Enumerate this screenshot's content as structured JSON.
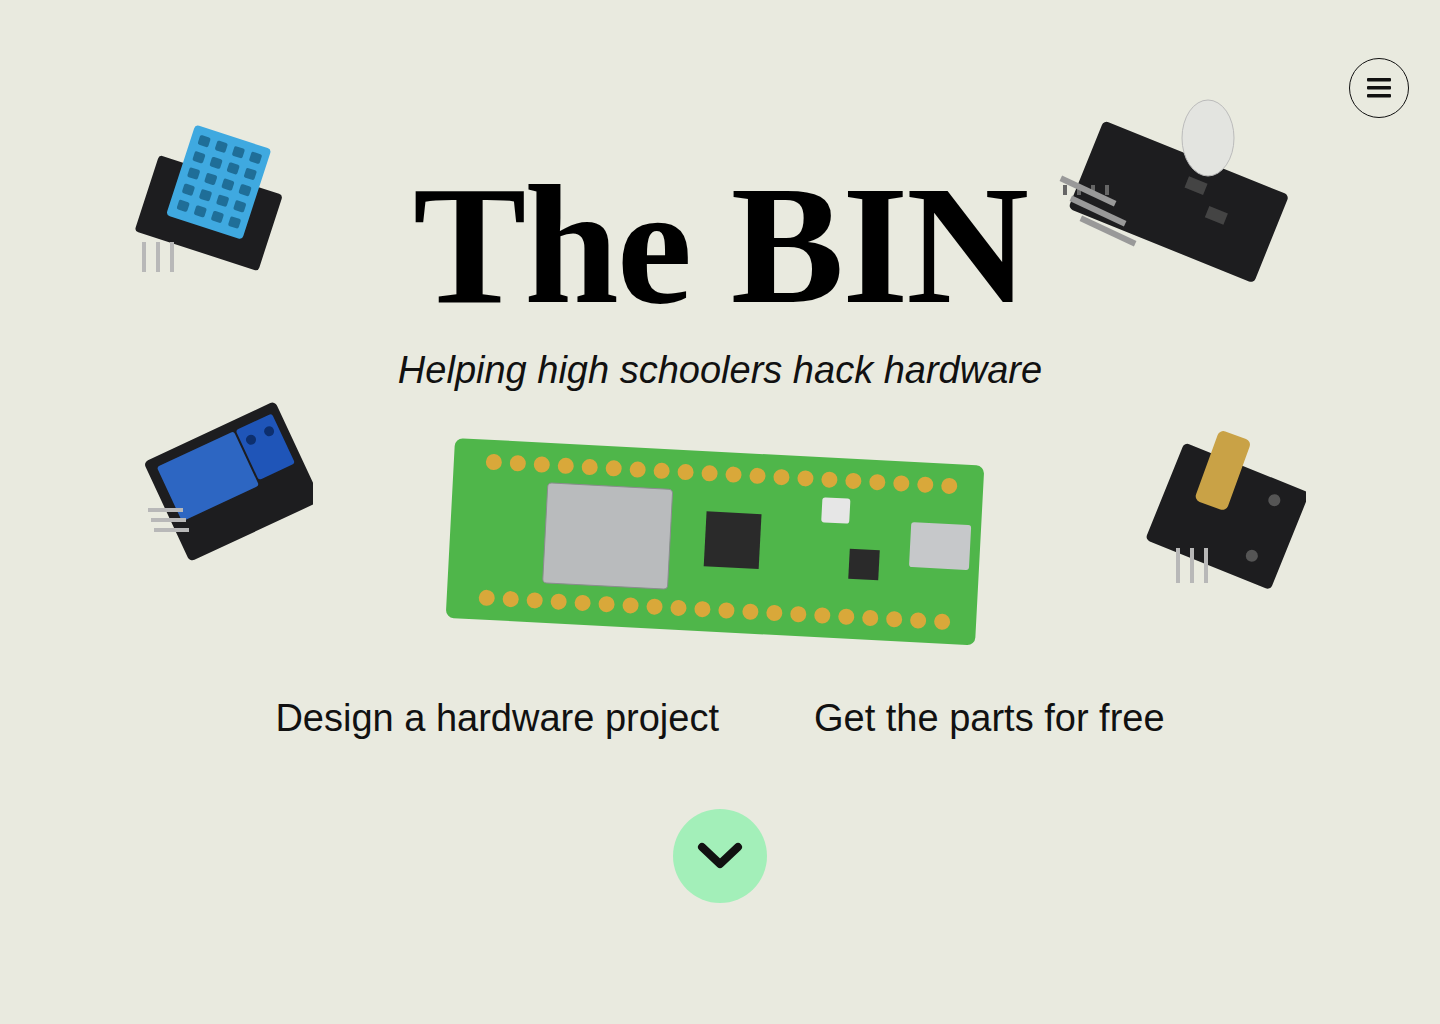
{
  "logo": {
    "title": "The BIN",
    "tagline": "Helping high schoolers hack hardware"
  },
  "steps": [
    "Design a hardware project",
    "Get the parts for free"
  ]
}
